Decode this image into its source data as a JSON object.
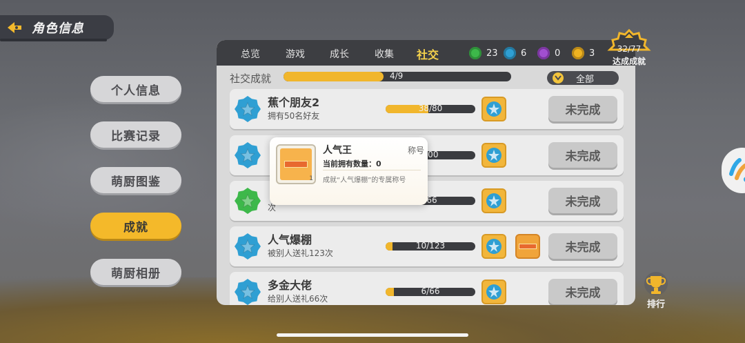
{
  "header": {
    "title": "角色信息"
  },
  "menu": [
    {
      "label": "个人信息",
      "active": false
    },
    {
      "label": "比赛记录",
      "active": false
    },
    {
      "label": "萌厨图鉴",
      "active": false
    },
    {
      "label": "成就",
      "active": true
    },
    {
      "label": "萌厨相册",
      "active": false
    }
  ],
  "tabs": [
    {
      "label": "总览",
      "active": false
    },
    {
      "label": "游戏",
      "active": false
    },
    {
      "label": "成长",
      "active": false
    },
    {
      "label": "收集",
      "active": false
    },
    {
      "label": "社交",
      "active": true
    }
  ],
  "gems": [
    {
      "color": "#3db84a",
      "count": "23"
    },
    {
      "color": "#2f9fd3",
      "count": "6"
    },
    {
      "color": "#a14fd0",
      "count": "0"
    },
    {
      "color": "#efb321",
      "count": "3"
    }
  ],
  "achievement_total": {
    "count": "32/77",
    "label": "达成成就"
  },
  "category": {
    "label": "社交成就",
    "progress_text": "4/9",
    "progress": 0.44
  },
  "filter": {
    "label": "全部"
  },
  "achievements": [
    {
      "title": "蕉个朋友2",
      "desc": "拥有50名好友",
      "progress_text": "38/80",
      "progress": 0.475,
      "badge_color": "#2f9fd3",
      "status": "未完成",
      "extra_reward": false
    },
    {
      "title": "",
      "desc": "",
      "progress_text": "100",
      "progress": 0.0,
      "badge_color": "#2f9fd3",
      "status": "未完成",
      "extra_reward": false
    },
    {
      "title": "",
      "desc": "次",
      "progress_text": "/66",
      "progress": 0.0,
      "badge_color": "#3db84a",
      "status": "未完成",
      "extra_reward": false
    },
    {
      "title": "人气爆棚",
      "desc": "被别人送礼123次",
      "progress_text": "10/123",
      "progress": 0.08,
      "badge_color": "#2f9fd3",
      "status": "未完成",
      "extra_reward": true
    },
    {
      "title": "多金大佬",
      "desc": "给别人送礼66次",
      "progress_text": "6/66",
      "progress": 0.09,
      "badge_color": "#2f9fd3",
      "status": "未完成",
      "extra_reward": false
    }
  ],
  "popup": {
    "title": "人气王",
    "type": "称号",
    "owned": "当前拥有数量：0",
    "desc": "成就“人气爆棚”的专属称号",
    "quantity": "1"
  },
  "rank": {
    "label": "排行"
  }
}
